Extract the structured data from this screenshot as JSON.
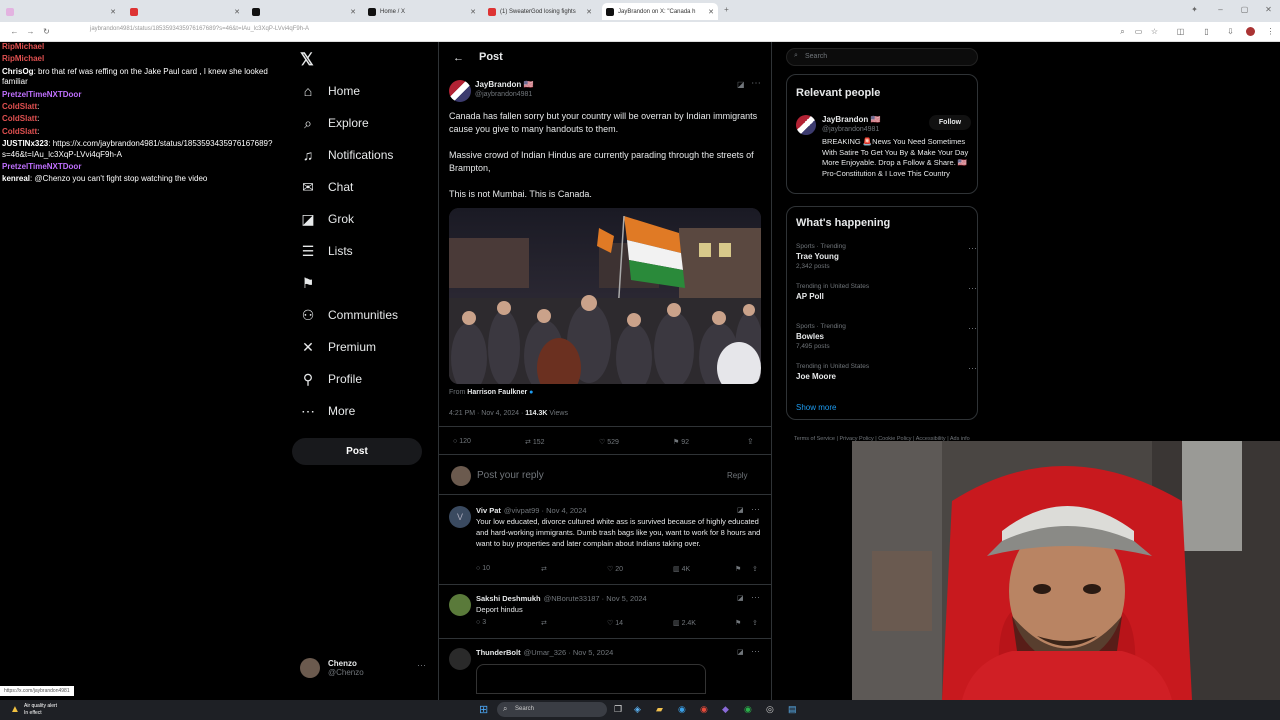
{
  "browser": {
    "tabs": [
      {
        "title": "",
        "color": "#e3b3e0"
      },
      {
        "title": "",
        "color": "#d33"
      },
      {
        "title": "",
        "color": "#111"
      },
      {
        "title": "Home / X",
        "color": "#111"
      },
      {
        "title": "(1) SweaterGod losing fights",
        "color": "#d33"
      },
      {
        "title": "JayBrandon on X: \"Canada h",
        "color": "#111"
      }
    ],
    "url": "jaybrandon4981/status/1853593435976167689?s=46&t=IAu_lc3XqP-LVvi4qF9h-A",
    "statusbar_url": "https://x.com/jaybrandon4981"
  },
  "chat": {
    "messages": [
      {
        "user": "RipMichael",
        "text": "",
        "user_color": "#e05050"
      },
      {
        "user": "RipMichael",
        "text": "",
        "user_color": "#e05050"
      },
      {
        "user": "ChrisOg",
        "text": ": bro that ref was reffing on the Jake Paul card , I knew she looked familiar",
        "user_color": "#ffffff"
      },
      {
        "user": "PretzelTimeNXTDoor",
        "text": "",
        "user_color": "#c070ff"
      },
      {
        "user": "ColdSlatt",
        "text": ":",
        "user_color": "#e05050"
      },
      {
        "user": "ColdSlatt",
        "text": ":",
        "user_color": "#e05050"
      },
      {
        "user": "ColdSlatt",
        "text": ":",
        "user_color": "#e05050"
      },
      {
        "user": "JUSTINx323",
        "text": ": https://x.com/jaybrandon4981/status/1853593435976167689?s=46&t=IAu_lc3XqP-LVvi4qF9h-A",
        "user_color": "#ffffff"
      },
      {
        "user": "PretzelTimeNXTDoor",
        "text": "",
        "user_color": "#c070ff"
      },
      {
        "user": "kenreal",
        "text": ": @Chenzo you can't fight stop watching the video",
        "user_color": "#ffffff"
      }
    ]
  },
  "nav": {
    "items": [
      {
        "label": "Home",
        "icon": "home-icon",
        "glyph": "⌂"
      },
      {
        "label": "Explore",
        "icon": "search-icon",
        "glyph": "⌕"
      },
      {
        "label": "Notifications",
        "icon": "bell-icon",
        "glyph": "♫"
      },
      {
        "label": "Chat",
        "icon": "chat-icon",
        "glyph": "✉"
      },
      {
        "label": "Grok",
        "icon": "grok-icon",
        "glyph": "◪"
      },
      {
        "label": "Lists",
        "icon": "list-icon",
        "glyph": "☰"
      },
      {
        "label": "",
        "icon": "bookmark-icon",
        "glyph": "⚑"
      },
      {
        "label": "Communities",
        "icon": "communities-icon",
        "glyph": "⚇"
      },
      {
        "label": "Premium",
        "icon": "x-logo-icon",
        "glyph": "✕"
      },
      {
        "label": "Profile",
        "icon": "profile-icon",
        "glyph": "⚲"
      },
      {
        "label": "More",
        "icon": "more-icon",
        "glyph": "⋯"
      }
    ],
    "post_button": "Post",
    "account": {
      "name": "Chenzo",
      "handle": "@Chenzo"
    }
  },
  "main": {
    "header_title": "Post",
    "tweet": {
      "author": "JayBrandon 🇺🇸",
      "handle": "@jaybrandon4981",
      "text1": "Canada has fallen sorry but your country will be overran by Indian immigrants cause you give to many handouts to them.",
      "text2": "Massive crowd of Indian Hindus are currently parading through the streets of Brampton,",
      "text3": "This is not Mumbai. This is Canada.",
      "from_label": "From",
      "from_name": "Harrison Faulkner",
      "time": "4:21 PM · Nov 4, 2024 ·",
      "views": "114.3K",
      "views_label": "Views",
      "replies": "120",
      "reposts": "152",
      "likes": "529",
      "bookmarks": "92"
    },
    "reply_box": {
      "placeholder": "Post your reply",
      "button": "Reply"
    },
    "replies": [
      {
        "name": "Viv Pat",
        "handle": "@vivpat99 · Nov 4, 2024",
        "avatar_letter": "V",
        "text": "Your low educated, divorce cultured white ass is survived because of highly educated and hard-working immigrants. Dumb trash bags like you, want to work for 8 hours and want to buy properties and later complain about Indians taking over.",
        "replies": "10",
        "likes": "20",
        "views": "4K"
      },
      {
        "name": "Sakshi Deshmukh",
        "handle": "@NBorute33187 · Nov 5, 2024",
        "avatar_letter": "",
        "text": "Deport hindus",
        "replies": "3",
        "likes": "14",
        "views": "2.4K"
      },
      {
        "name": "ThunderBolt",
        "handle": "@Umar_326 · Nov 5, 2024",
        "avatar_letter": "",
        "text": "",
        "replies": "",
        "likes": "",
        "views": ""
      }
    ]
  },
  "right": {
    "search_placeholder": "Search",
    "relevant_title": "Relevant people",
    "relevant": {
      "name": "JayBrandon 🇺🇸",
      "handle": "@jaybrandon4981",
      "follow": "Follow",
      "bio": "BREAKING 🚨News You Need Sometimes With Satire To Get You By & Make Your Day More Enjoyable. Drop a Follow & Share. 🇺🇸Pro-Constitution & I Love This Country"
    },
    "happening_title": "What's happening",
    "trends": [
      {
        "context": "Sports · Trending",
        "name": "Trae Young",
        "count": "2,342 posts"
      },
      {
        "context": "Trending in United States",
        "name": "AP Poll",
        "count": ""
      },
      {
        "context": "Sports · Trending",
        "name": "Bowles",
        "count": "7,495 posts"
      },
      {
        "context": "Trending in United States",
        "name": "Joe Moore",
        "count": ""
      }
    ],
    "show_more": "Show more",
    "footer": [
      "Terms of Service",
      "Privacy Policy",
      "Cookie Policy",
      "Accessibility",
      "Ads info"
    ]
  },
  "taskbar": {
    "weather": "Air quality alert",
    "weather_sub": "In effect",
    "search": "Search"
  }
}
